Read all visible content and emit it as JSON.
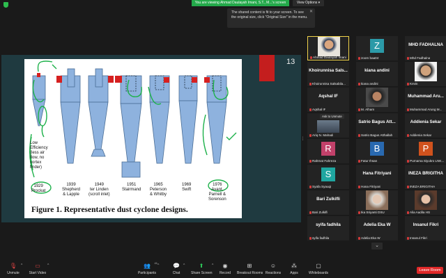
{
  "topbar": {
    "viewing_text": "You are viewing Ahmad Daulayah Imani, S.T., M...'s screen",
    "view_options": "View Options",
    "tooltip": "The shared content is fit to your screen. To see the original size, click \"Original Size\" in the menu."
  },
  "slide": {
    "page_number": "13",
    "caption": "Figure 1. Representative dust cyclone designs.",
    "labels": [
      "1929\nProckat",
      "1939\nShepherd\n& Lapple",
      "1949\nter Linden\n(scroll inlet)",
      "1951\nStairmand",
      "1965\nPeterson\n& Whitby",
      "1969\nSwift",
      "1976\nAvant,\nParnell &\nSorenson"
    ],
    "annotation": "Low\nEfficiency\n(less air\nflow, no\nvortex\nfinder)",
    "colors": {
      "body": "#8eb2de",
      "inlet": "#d62020",
      "outline": "#4a6d95",
      "pen": "#1db14a"
    }
  },
  "gallery": {
    "tiles": [
      {
        "label": "Ahmad Daulayah Imani",
        "type": "photo",
        "active": true
      },
      {
        "label": "zoom baa04",
        "type": "letter",
        "letter": "Z",
        "color": "#2b9aa8"
      },
      {
        "label": "Mhd Fadhalna",
        "type": "text",
        "overlay": "MHD FADHALNA"
      },
      {
        "label": "Khoirunnisa Salsabila...",
        "type": "text",
        "overlay": "Khoirunnisa Sals..."
      },
      {
        "label": "kiana andini",
        "type": "text",
        "overlay": "kiana andini"
      },
      {
        "label": "Kevin",
        "type": "photo2"
      },
      {
        "label": "Aqshal IF",
        "type": "text",
        "overlay": "Aqshal IF"
      },
      {
        "label": "M. Alham",
        "type": "photo3"
      },
      {
        "label": "Muhammad Arung M...",
        "type": "text",
        "overlay": "Muhammad Aru..."
      },
      {
        "label": "Ariq N. Mahadi",
        "type": "ask",
        "ask": "Ask to Unmute"
      },
      {
        "label": "Satrio Bagus Atthallah",
        "type": "text",
        "overlay": "Satrio Bagus Att..."
      },
      {
        "label": "Addienia Sekar",
        "type": "text",
        "overlay": "Addienia Sekar"
      },
      {
        "label": "Rahmat Fahreza",
        "type": "letter",
        "letter": "R",
        "color": "#c2416a"
      },
      {
        "label": "Fatur Ihsan",
        "type": "letter",
        "letter": "B",
        "color": "#2969b0"
      },
      {
        "label": "Purnama Siyukro LNK...",
        "type": "letter",
        "letter": "P",
        "color": "#d0521d"
      },
      {
        "label": "Syafa Syauqi",
        "type": "letter",
        "letter": "S",
        "color": "#1fa6a0"
      },
      {
        "label": "Hana Fitriyani",
        "type": "text",
        "overlay": "Hana Fitriyani"
      },
      {
        "label": "INEZA BRIGITHA",
        "type": "text",
        "overlay": "INEZA BRIGITHA"
      },
      {
        "label": "Bari Zulkifli",
        "type": "text",
        "overlay": "Bari Zulkifli"
      },
      {
        "label": "Ika Sriyanti DSU",
        "type": "photo4"
      },
      {
        "label": "Alia Aadila HS",
        "type": "photo5"
      },
      {
        "label": "syifa fadhila",
        "type": "text",
        "overlay": "syifa fadhila"
      },
      {
        "label": "Adelia Eka W",
        "type": "text",
        "overlay": "Adelia Eka W"
      },
      {
        "label": "Insanul Fikri",
        "type": "text",
        "overlay": "Insanul Fikri"
      }
    ]
  },
  "toolbar": {
    "unmute": "Unmute",
    "start_video": "Start Video",
    "participants": "Participants",
    "participants_count": "41",
    "chat": "Chat",
    "share_screen": "Share Screen",
    "record": "Record",
    "breakout": "Breakout Rooms",
    "reactions": "Reactions",
    "apps": "Apps",
    "whiteboards": "Whiteboards",
    "leave": "Leave Room"
  }
}
